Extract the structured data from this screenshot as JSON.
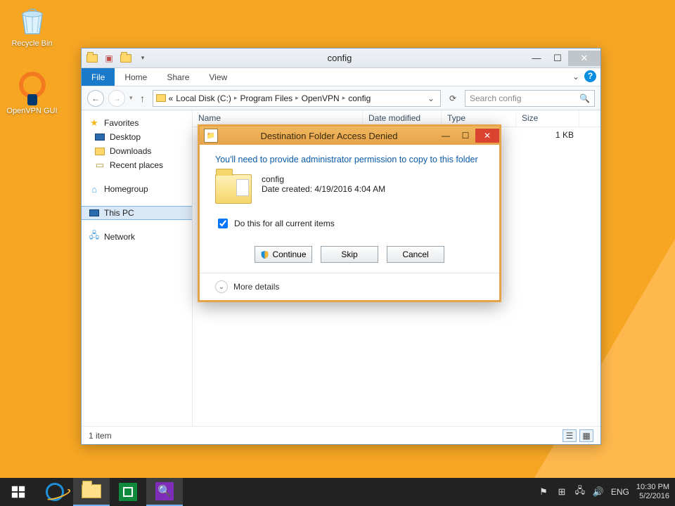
{
  "desktop": {
    "recycle_bin": "Recycle Bin",
    "ovpn_gui": "OpenVPN GUI"
  },
  "explorer": {
    "title": "config",
    "tabs": {
      "file": "File",
      "home": "Home",
      "share": "Share",
      "view": "View"
    },
    "crumbs": {
      "prefix": "«",
      "c0": "Local Disk (C:)",
      "c1": "Program Files",
      "c2": "OpenVPN",
      "c3": "config"
    },
    "search_placeholder": "Search config",
    "columns": {
      "name": "Name",
      "date": "Date modified",
      "type": "Type",
      "size": "Size"
    },
    "nav": {
      "favorites": "Favorites",
      "desktop": "Desktop",
      "downloads": "Downloads",
      "recent": "Recent places",
      "homegroup": "Homegroup",
      "thispc": "This PC",
      "network": "Network"
    },
    "row": {
      "size": "1 KB"
    },
    "status": "1 item"
  },
  "dialog": {
    "title": "Destination Folder Access Denied",
    "msg": "You'll need to provide administrator permission to copy to this folder",
    "item_name": "config",
    "item_date": "Date created: 4/19/2016 4:04 AM",
    "checkbox": "Do this for all current items",
    "continue": "Continue",
    "skip": "Skip",
    "cancel": "Cancel",
    "more": "More details"
  },
  "tray": {
    "lang": "ENG",
    "time": "10:30 PM",
    "date": "5/2/2016"
  }
}
